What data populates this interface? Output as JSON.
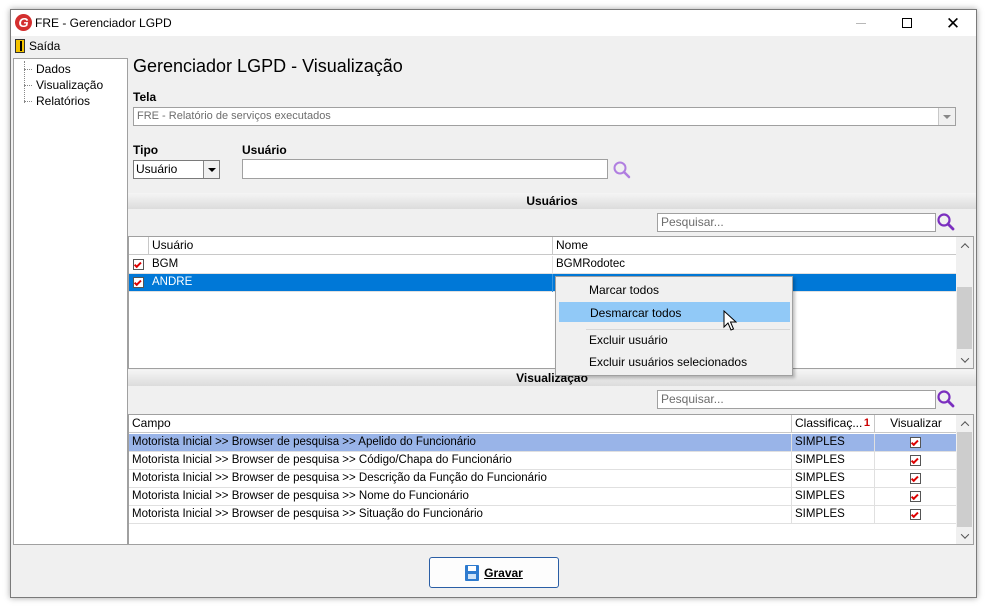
{
  "window": {
    "title": "FRE - Gerenciador LGPD",
    "app_icon_letter": "G"
  },
  "menu": {
    "exit_label": "Saída"
  },
  "tree": {
    "items": [
      "Dados",
      "Visualização",
      "Relatórios"
    ]
  },
  "main": {
    "title": "Gerenciador LGPD - Visualização",
    "tela_label": "Tela",
    "tela_value": "FRE - Relatório de serviços executados",
    "tipo_label": "Tipo",
    "tipo_value": "Usuário",
    "usuario_label": "Usuário",
    "usuario_value": ""
  },
  "usuarios": {
    "section_title": "Usuários",
    "search_placeholder": "Pesquisar...",
    "columns": [
      "Usuário",
      "Nome"
    ],
    "rows": [
      {
        "checked": true,
        "usuario": "BGM",
        "nome": "BGMRodotec",
        "selected": false
      },
      {
        "checked": true,
        "usuario": "ANDRE",
        "nome": "",
        "selected": true
      }
    ]
  },
  "context_menu": {
    "items": [
      "Marcar todos",
      "Desmarcar todos",
      "Excluir usuário",
      "Excluir usuários selecionados"
    ],
    "highlighted_index": 1
  },
  "visualizacao": {
    "section_title": "Visualização",
    "search_placeholder": "Pesquisar...",
    "columns": [
      "Campo",
      "Classificaç...",
      "Visualizar"
    ],
    "sort_indicator": "1",
    "rows": [
      {
        "campo": "Motorista Inicial >> Browser de pesquisa >> Apelido do Funcionário",
        "classificacao": "SIMPLES",
        "visualizar": true,
        "selected": true
      },
      {
        "campo": "Motorista Inicial >> Browser de pesquisa >> Código/Chapa do Funcionário",
        "classificacao": "SIMPLES",
        "visualizar": true,
        "selected": false
      },
      {
        "campo": "Motorista Inicial >> Browser de pesquisa >> Descrição da Função do Funcionário",
        "classificacao": "SIMPLES",
        "visualizar": true,
        "selected": false
      },
      {
        "campo": "Motorista Inicial >> Browser de pesquisa >> Nome do Funcionário",
        "classificacao": "SIMPLES",
        "visualizar": true,
        "selected": false
      },
      {
        "campo": "Motorista Inicial >> Browser de pesquisa >> Situação do Funcionário",
        "classificacao": "SIMPLES",
        "visualizar": true,
        "selected": false
      }
    ]
  },
  "footer": {
    "save_label": "Gravar"
  },
  "colors": {
    "selection_blue": "#0078d7",
    "row_highlight": "#99b4e8",
    "menu_highlight": "#91c9f7",
    "search_icon": "#7b2fbf",
    "check_red": "#dd0000"
  }
}
